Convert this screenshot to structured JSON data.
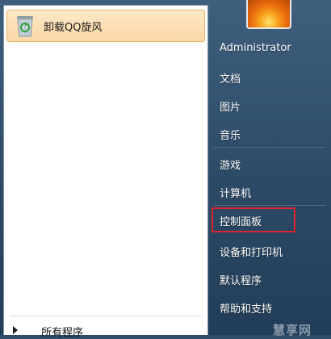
{
  "left": {
    "pinned": [
      {
        "label": "卸载QQ旋风",
        "icon": "recycle-bin-icon"
      }
    ],
    "all_programs_label": "所有程序"
  },
  "right": {
    "items": [
      {
        "label": "Administrator"
      },
      {
        "label": "文档"
      },
      {
        "label": "图片"
      },
      {
        "label": "音乐"
      },
      {
        "label": "游戏"
      },
      {
        "label": "计算机"
      },
      {
        "label": "控制面板"
      },
      {
        "label": "设备和打印机"
      },
      {
        "label": "默认程序"
      },
      {
        "label": "帮助和支持"
      }
    ]
  },
  "watermark": "慧享网",
  "colors": {
    "highlight": "#e0232c",
    "pinned_bg": "#fbd8a6"
  }
}
